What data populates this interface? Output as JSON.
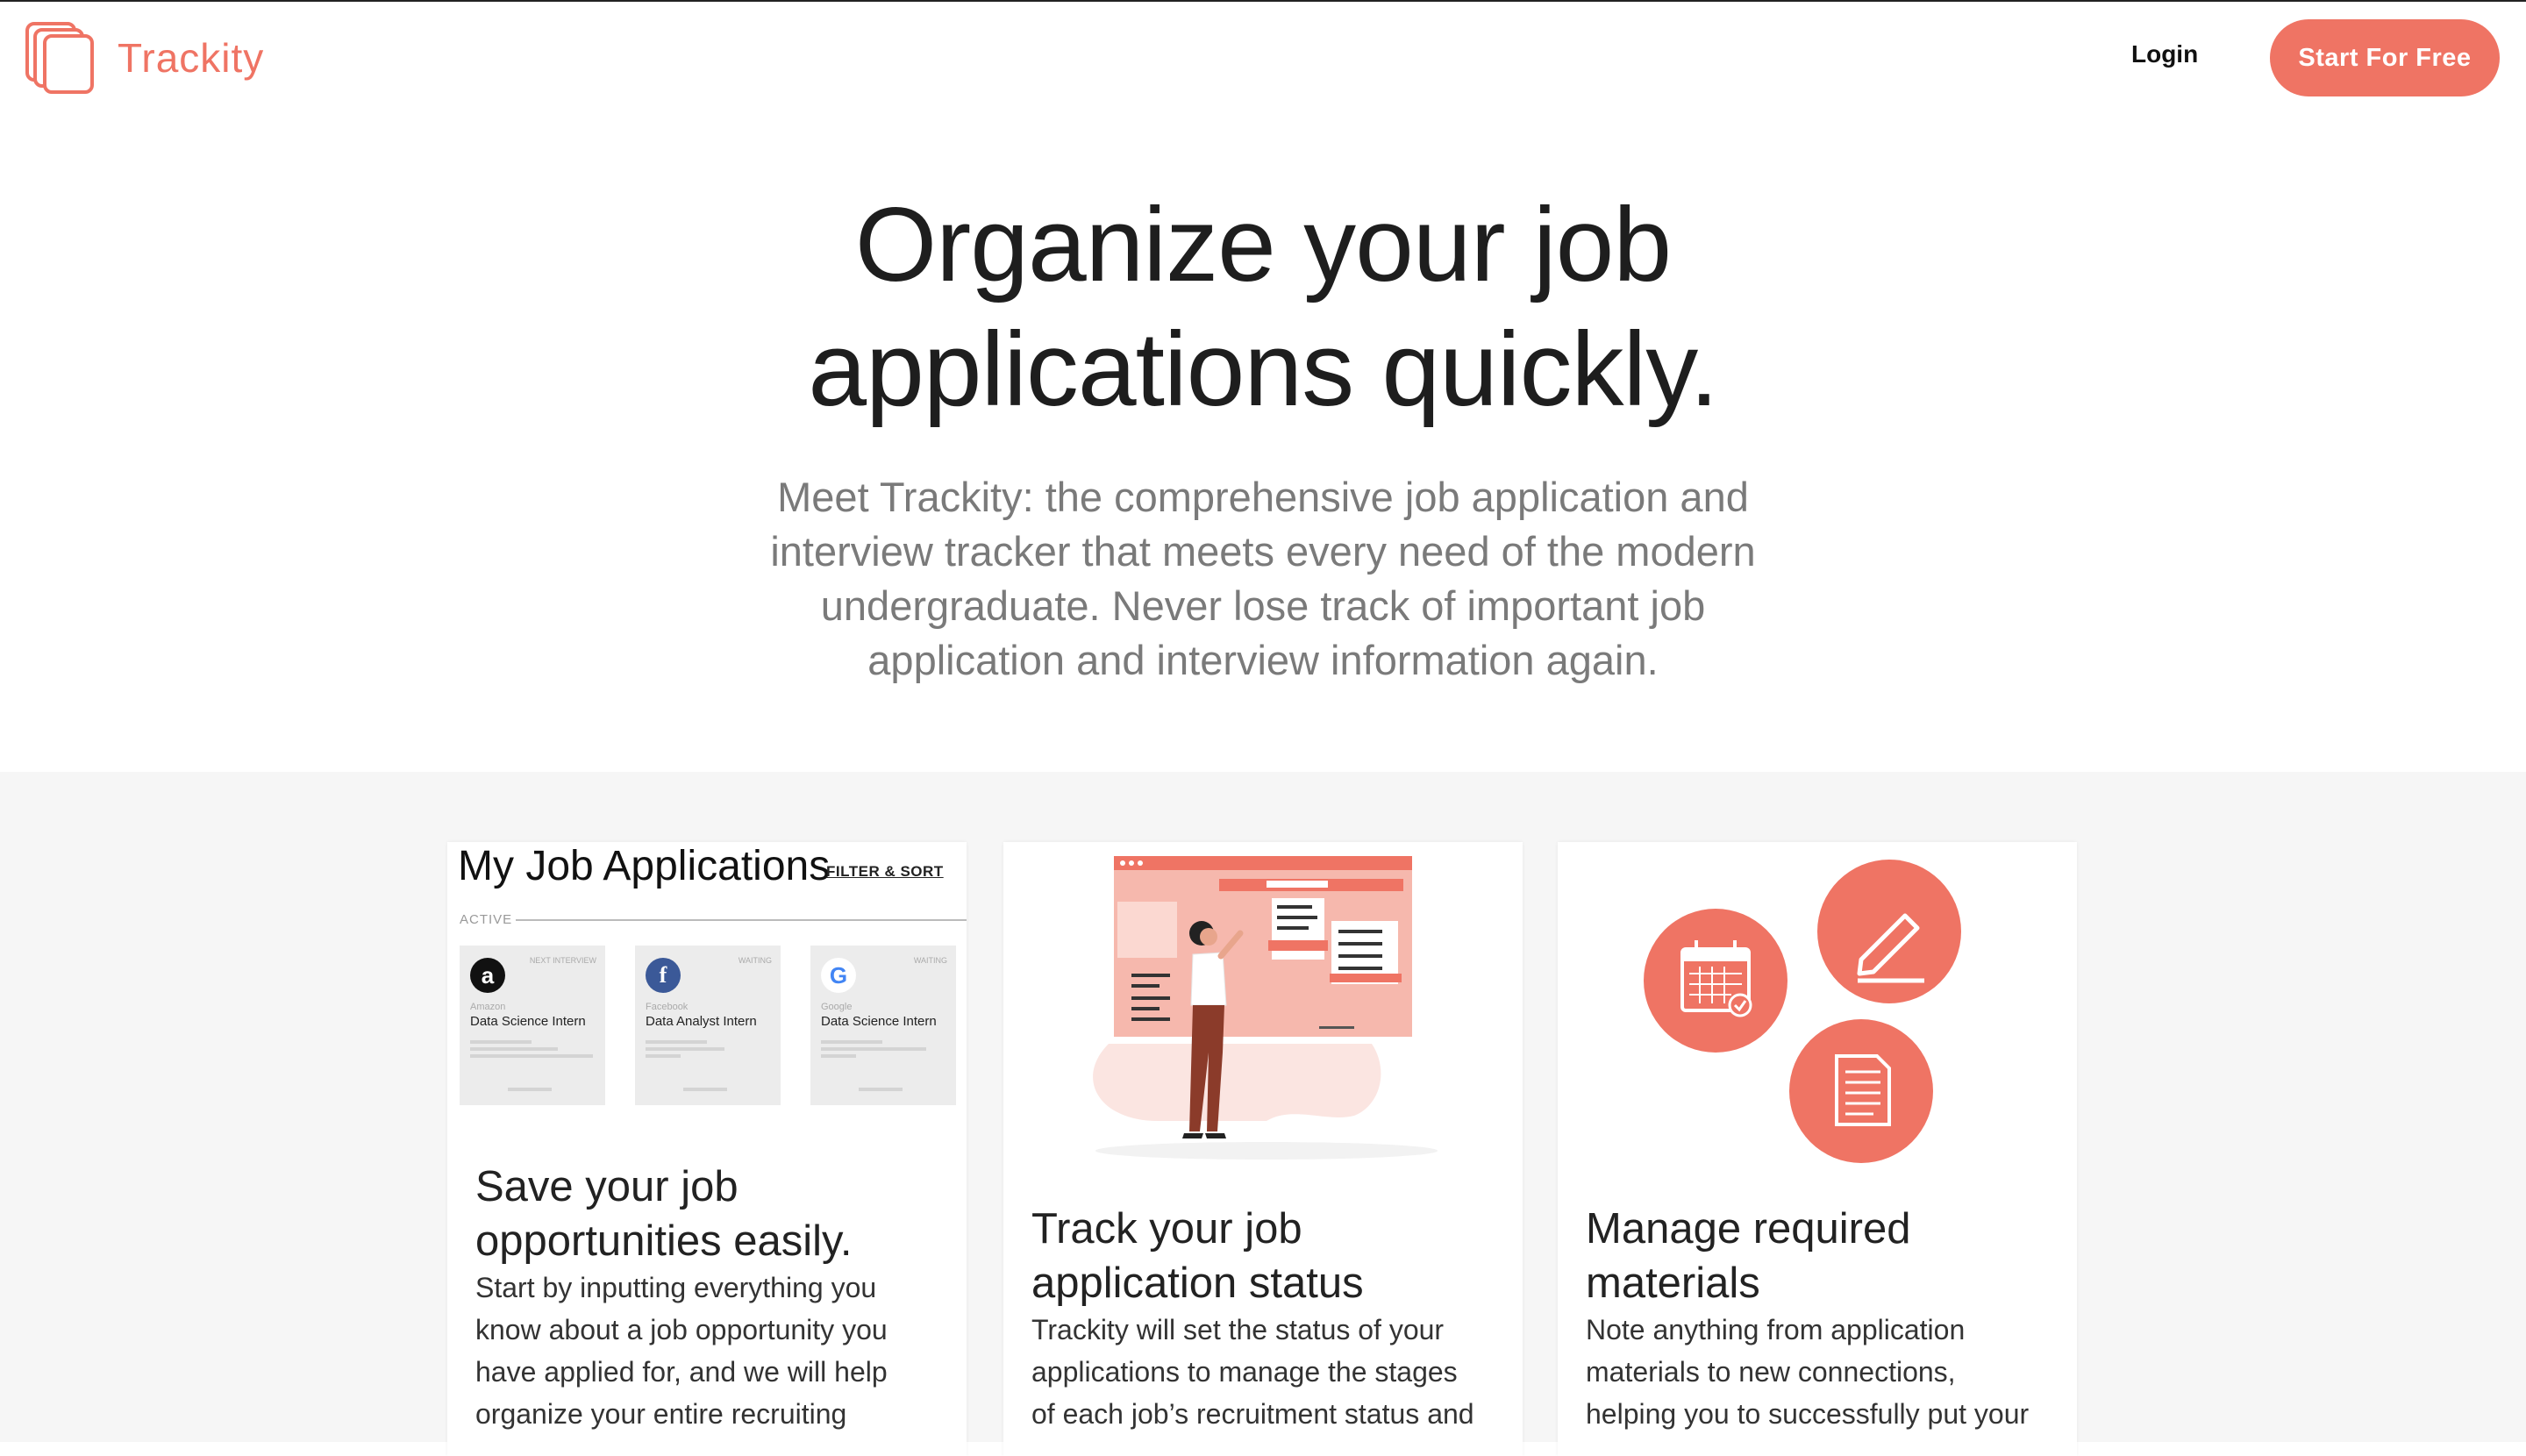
{
  "brand": {
    "name": "Trackity",
    "color": "#ef7464",
    "icon": "stacked-pages-logo"
  },
  "nav": {
    "login": "Login",
    "cta": "Start For Free"
  },
  "hero": {
    "title_line1": "Organize your job",
    "title_line2": "applications quickly.",
    "subtitle": "Meet Trackity: the comprehensive job application and interview tracker that meets every need of the modern undergraduate. Never lose track of important job application and interview information again."
  },
  "mockup": {
    "title": "My Job Applications",
    "filter": "FILTER & SORT",
    "section": "ACTIVE",
    "jobs": [
      {
        "status": "NEXT INTERVIEW",
        "company": "Amazon",
        "role": "Data Science Intern",
        "icon": "amazon-logo"
      },
      {
        "status": "WAITING",
        "company": "Facebook",
        "role": "Data Analyst Intern",
        "icon": "facebook-logo"
      },
      {
        "status": "WAITING",
        "company": "Google",
        "role": "Data Science Intern",
        "icon": "google-logo"
      }
    ]
  },
  "features": [
    {
      "title_line1": "Save your job",
      "title_line2": "opportunities easily.",
      "body": "Start by inputting everything you know about a job opportunity you have applied for, and we will help organize your entire recruiting"
    },
    {
      "title_line1": "Track your job",
      "title_line2": "application status",
      "body": "Trackity will set the status of your applications to manage the stages of each job’s recruitment status and"
    },
    {
      "title_line1": "Manage required",
      "title_line2": "materials",
      "body": "Note anything from application materials to new connections, helping you to successfully put your"
    }
  ],
  "colors": {
    "accent": "#ef7464",
    "section_bg": "#f6f6f6"
  }
}
